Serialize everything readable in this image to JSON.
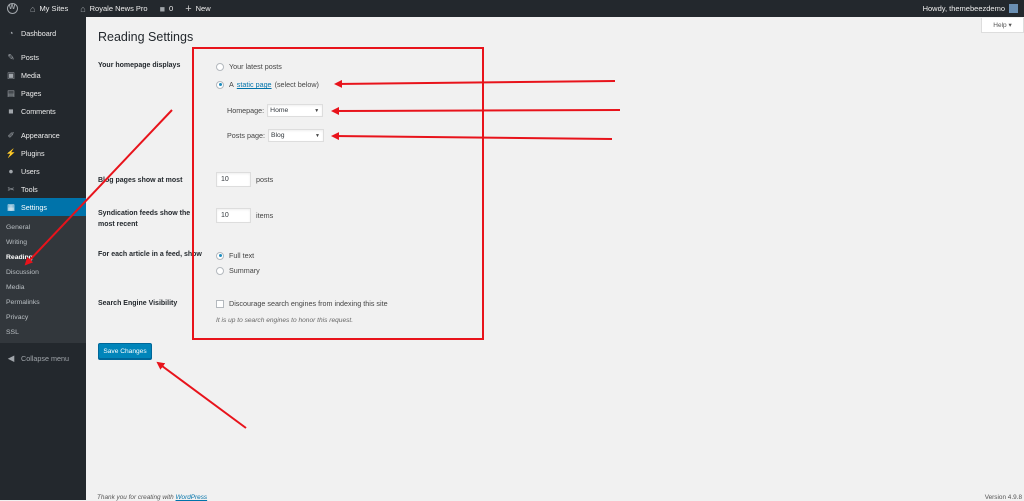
{
  "adminbar": {
    "my_sites": "My Sites",
    "site_name": "Royale News Pro",
    "comments_count": "0",
    "new_label": "New",
    "howdy": "Howdy, themebeezdemo"
  },
  "sidebar": {
    "items": [
      {
        "label": "Dashboard",
        "icon": "dashboard-icon"
      },
      {
        "label": "Posts",
        "icon": "pin-icon"
      },
      {
        "label": "Media",
        "icon": "media-icon"
      },
      {
        "label": "Pages",
        "icon": "pages-icon"
      },
      {
        "label": "Comments",
        "icon": "comment-icon"
      },
      {
        "label": "Appearance",
        "icon": "brush-icon"
      },
      {
        "label": "Plugins",
        "icon": "plugin-icon"
      },
      {
        "label": "Users",
        "icon": "user-icon"
      },
      {
        "label": "Tools",
        "icon": "wrench-icon"
      },
      {
        "label": "Settings",
        "icon": "settings-icon"
      }
    ],
    "submenu": [
      "General",
      "Writing",
      "Reading",
      "Discussion",
      "Media",
      "Permalinks",
      "Privacy",
      "SSL"
    ],
    "collapse": "Collapse menu"
  },
  "help": "Help ▾",
  "page": {
    "title": "Reading Settings",
    "homepage_displays": {
      "label": "Your homepage displays",
      "option_latest": "Your latest posts",
      "option_static_prefix": "A",
      "option_static_link": "static page",
      "option_static_suffix": "(select below)",
      "homepage_label": "Homepage:",
      "homepage_value": "Home",
      "posts_page_label": "Posts page:",
      "posts_page_value": "Blog"
    },
    "blog_pages": {
      "label": "Blog pages show at most",
      "value": "10",
      "unit": "posts"
    },
    "syndication": {
      "label_line1": "Syndication feeds show the",
      "label_line2": "most recent",
      "value": "10",
      "unit": "items"
    },
    "feed_article": {
      "label": "For each article in a feed, show",
      "option_full": "Full text",
      "option_summary": "Summary"
    },
    "search_visibility": {
      "label": "Search Engine Visibility",
      "checkbox_label": "Discourage search engines from indexing this site",
      "description": "It is up to search engines to honor this request."
    },
    "save_button": "Save Changes"
  },
  "footer": {
    "thanks_prefix": "Thank you for creating with",
    "thanks_link": "WordPress",
    "version": "Version 4.9.8"
  },
  "colors": {
    "annotation": "#e8131b",
    "primary": "#0085ba",
    "sidebar_bg": "#23282d",
    "current_menu": "#0073aa"
  }
}
